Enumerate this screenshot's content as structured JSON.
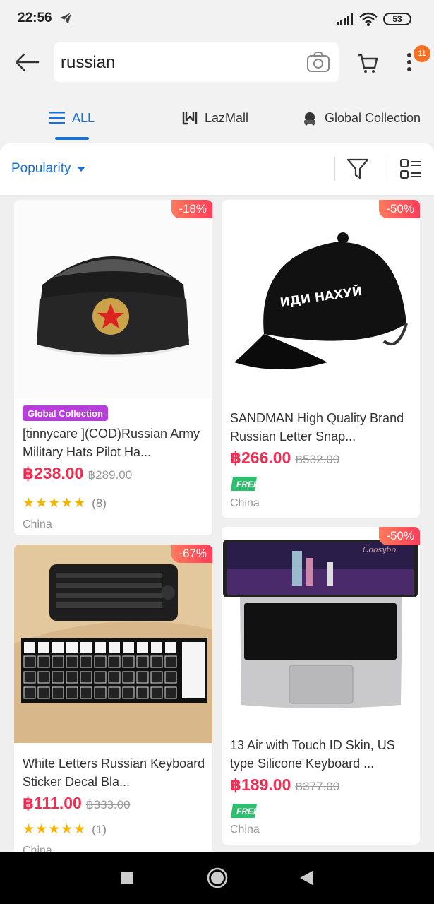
{
  "status_bar": {
    "time": "22:56",
    "battery": "53"
  },
  "search": {
    "query": "russian",
    "cart_badge": "11"
  },
  "tabs": [
    {
      "label": "ALL",
      "icon": "list-icon"
    },
    {
      "label": "LazMall",
      "icon": "lazmall-icon"
    },
    {
      "label": "Global Collection",
      "icon": "global-collection-icon"
    }
  ],
  "filter": {
    "sort_label": "Popularity"
  },
  "products": [
    {
      "discount": "-18%",
      "tag": "Global Collection",
      "title": "[tinnycare ](COD)Russian Army Military Hats Pilot Ha...",
      "price": "฿238.00",
      "original_price": "฿289.00",
      "rating_stars": "★★★★★",
      "rating_count": "(8)",
      "location": "China"
    },
    {
      "discount": "-50%",
      "title": "SANDMAN High Quality Brand Russian Letter Snap...",
      "image_text": "ИДИ НАХУЙ",
      "price": "฿266.00",
      "original_price": "฿532.00",
      "free_label": "FREE",
      "location": "China"
    },
    {
      "discount": "-67%",
      "title": "White Letters Russian Keyboard Sticker Decal Bla...",
      "price": "฿111.00",
      "original_price": "฿333.00",
      "rating_stars": "★★★★★",
      "rating_count": "(1)",
      "location": "China"
    },
    {
      "discount": "-50%",
      "title": "13  Air with Touch ID Skin, US type Silicone Keyboard ...",
      "image_brand": "Coosybo",
      "price": "฿189.00",
      "original_price": "฿377.00",
      "free_label": "FREE",
      "location": "China"
    }
  ],
  "colors": {
    "accent": "#1a71d6",
    "price": "#f02d52",
    "badge": "#f57224",
    "discount": "#ff3d5a",
    "free": "#2bbf6e",
    "global_tag": "#b63fd9"
  }
}
